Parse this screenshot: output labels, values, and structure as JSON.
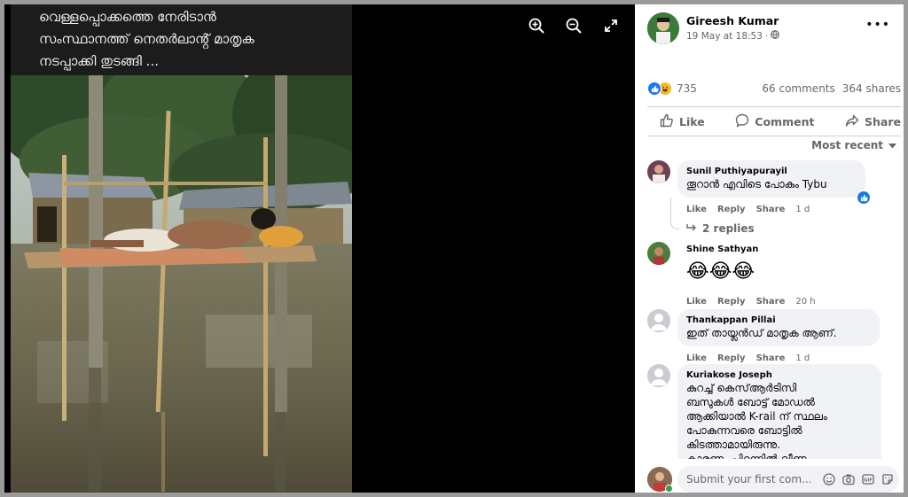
{
  "caption": {
    "lines": [
      "വെള്ളപ്പൊക്കത്തെ നേരിടാൻ",
      "സംസ്ഥാനത്ത് നെതർലാൻ്റ് മാതൃക",
      "നടപ്പാക്കി തുടങ്ങി ..."
    ]
  },
  "viewer_tools": {
    "icons": [
      "zoom-in-icon",
      "zoom-out-icon",
      "fullscreen-icon"
    ]
  },
  "post": {
    "author": "Gireesh Kumar",
    "timestamp": "19 May at 18:53",
    "privacy_separator": "·",
    "more": "•••",
    "reaction_count": "735",
    "comments": "66 comments",
    "shares": "364 shares",
    "actions": {
      "like": "Like",
      "comment": "Comment",
      "share": "Share"
    },
    "sort_label": "Most recent"
  },
  "comments": [
    {
      "name": "Sunil Puthiyapurayil",
      "text": "തൂറാൻ എവിടെ പോകും Tybu",
      "like": "Like",
      "reply": "Reply",
      "share": "Share",
      "time": "1 d",
      "replies": "2 replies"
    },
    {
      "name": "Shine Sathyan",
      "text": "😂😂😂",
      "like": "Like",
      "reply": "Reply",
      "share": "Share",
      "time": "20 h"
    },
    {
      "name": "Thankappan Pillai",
      "text": "ഇത് തായ്ലൻഡ് മാതൃക ആണ്.",
      "like": "Like",
      "reply": "Reply",
      "share": "Share",
      "time": "1 d"
    },
    {
      "name": "Kuriakose Joseph",
      "lines": [
        "കുറച്ച് കെസ്ആർടിസി",
        "ബസുകൾ ബോട്ട് മോഡൽ",
        "ആക്കിയാൽ K-rail ന് സ്ഥലം",
        "പോകുന്നവരെ ബോട്ടിൽ",
        "കിടത്താമായിരുന്നു.",
        "കാരണം പിറന്നിൽ വീണം"
      ]
    }
  ],
  "composer": {
    "placeholder": "Submit your first com..."
  },
  "colors": {
    "accent": "#1877f2",
    "secondary_text": "#65676b",
    "bubble": "#f0f2f5"
  }
}
